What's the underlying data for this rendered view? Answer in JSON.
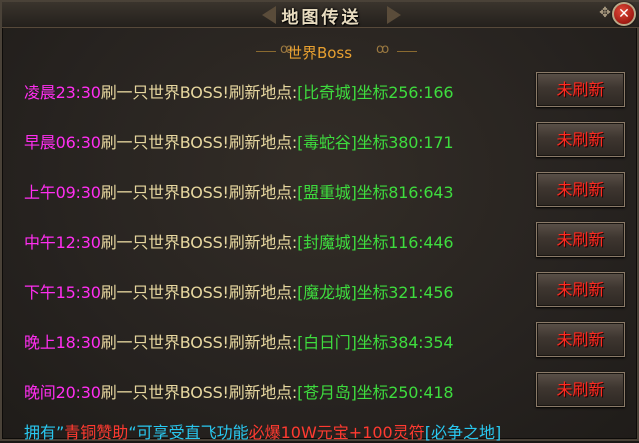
{
  "window": {
    "title": "地图传送",
    "close_icon": "close-icon"
  },
  "section": {
    "label": "世界Boss",
    "swirl_left": "ꝏ",
    "swirl_right": "ꝏ"
  },
  "rows": [
    {
      "time": "凌晨23:30",
      "text": "刷一只世界BOSS!刷新地点:",
      "place": "[比奇城]",
      "coord": "坐标256:166",
      "button": "未刷新"
    },
    {
      "time": "早晨06:30",
      "text": "刷一只世界BOSS!刷新地点:",
      "place": "[毒蛇谷]",
      "coord": "坐标380:171",
      "button": "未刷新"
    },
    {
      "time": "上午09:30",
      "text": "刷一只世界BOSS!刷新地点:",
      "place": "[盟重城]",
      "coord": "坐标816:643",
      "button": "未刷新"
    },
    {
      "time": "中午12:30",
      "text": "刷一只世界BOSS!刷新地点:",
      "place": "[封魔城]",
      "coord": "坐标116:446",
      "button": "未刷新"
    },
    {
      "time": "下午15:30",
      "text": "刷一只世界BOSS!刷新地点:",
      "place": "[魔龙城]",
      "coord": "坐标321:456",
      "button": "未刷新"
    },
    {
      "time": "晚上18:30",
      "text": "刷一只世界BOSS!刷新地点:",
      "place": "[白日门]",
      "coord": "坐标384:354",
      "button": "未刷新"
    },
    {
      "time": "晚间20:30",
      "text": "刷一只世界BOSS!刷新地点:",
      "place": "[苍月岛]",
      "coord": "坐标250:418",
      "button": "未刷新"
    }
  ],
  "footer": {
    "part1": "拥有”",
    "part2": "青铜赞助",
    "part3": "“可享受直飞功能",
    "part4": "必爆10W元宝+100灵符",
    "part5": "[必争之地]"
  },
  "colors": {
    "time": "#ff2ef0",
    "main": "#e8d8a0",
    "place": "#3edc3e",
    "button_text": "#ff2a20",
    "title": "#e8dcc0",
    "section": "#e8a030"
  }
}
